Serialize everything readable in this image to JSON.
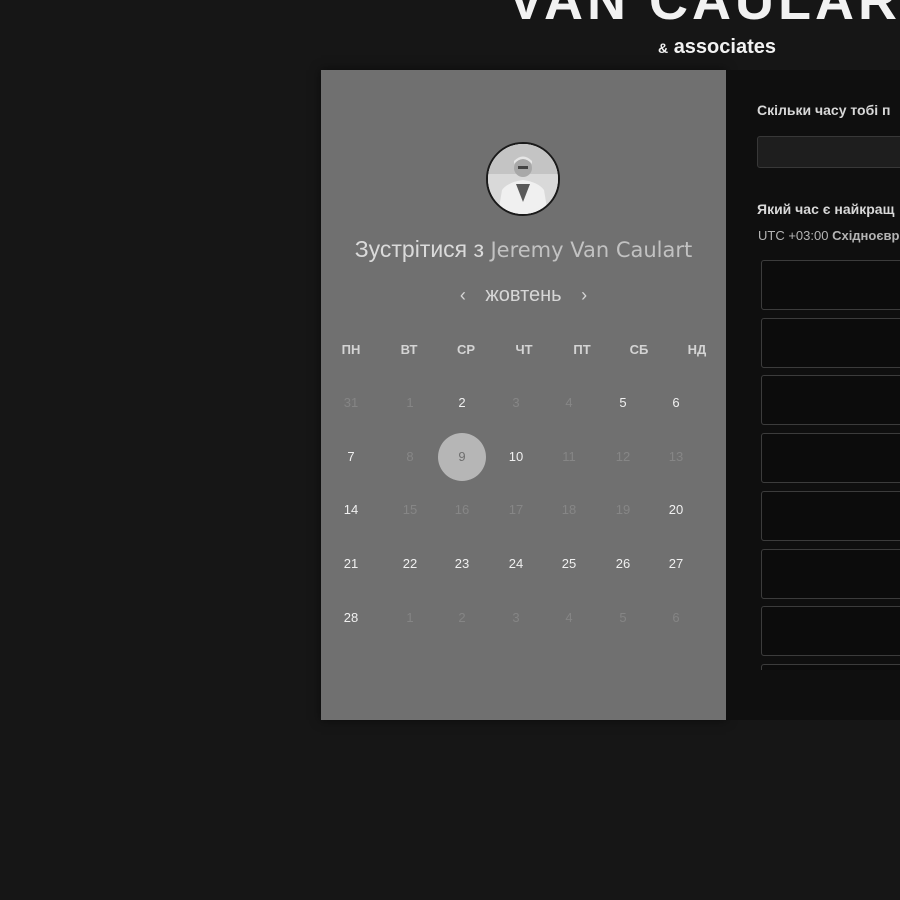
{
  "brand": {
    "name": "VAN CAULART",
    "sub_amp": "&",
    "sub": "associates"
  },
  "scheduler": {
    "avatar_alt": "Jeremy Van Caulart portrait",
    "title_prefix": "Зустрітися з",
    "host_name": "Jeremy Van Caulart",
    "month": "жовтень",
    "prev_arrow": "‹",
    "next_arrow": "›",
    "weekdays": [
      "ПН",
      "ВТ",
      "СР",
      "ЧТ",
      "ПТ",
      "СБ",
      "НД"
    ],
    "weeks": [
      [
        {
          "label": "31",
          "state": "other"
        },
        {
          "label": "1",
          "state": "disabled"
        },
        {
          "label": "2",
          "state": "available"
        },
        {
          "label": "3",
          "state": "disabled"
        },
        {
          "label": "4",
          "state": "disabled"
        },
        {
          "label": "5",
          "state": "available"
        },
        {
          "label": "6",
          "state": "available"
        }
      ],
      [
        {
          "label": "7",
          "state": "available"
        },
        {
          "label": "8",
          "state": "disabled"
        },
        {
          "label": "9",
          "state": "selected"
        },
        {
          "label": "10",
          "state": "available"
        },
        {
          "label": "11",
          "state": "disabled"
        },
        {
          "label": "12",
          "state": "disabled"
        },
        {
          "label": "13",
          "state": "disabled"
        }
      ],
      [
        {
          "label": "14",
          "state": "available"
        },
        {
          "label": "15",
          "state": "disabled"
        },
        {
          "label": "16",
          "state": "disabled"
        },
        {
          "label": "17",
          "state": "disabled"
        },
        {
          "label": "18",
          "state": "disabled"
        },
        {
          "label": "19",
          "state": "disabled"
        },
        {
          "label": "20",
          "state": "available"
        }
      ],
      [
        {
          "label": "21",
          "state": "available"
        },
        {
          "label": "22",
          "state": "available"
        },
        {
          "label": "23",
          "state": "available"
        },
        {
          "label": "24",
          "state": "available"
        },
        {
          "label": "25",
          "state": "available"
        },
        {
          "label": "26",
          "state": "available"
        },
        {
          "label": "27",
          "state": "available"
        }
      ],
      [
        {
          "label": "28",
          "state": "available"
        },
        {
          "label": "1",
          "state": "other"
        },
        {
          "label": "2",
          "state": "other"
        },
        {
          "label": "3",
          "state": "other"
        },
        {
          "label": "4",
          "state": "other"
        },
        {
          "label": "5",
          "state": "other"
        },
        {
          "label": "6",
          "state": "other"
        }
      ]
    ]
  },
  "booking": {
    "duration_question": "Скільки часу тобі п",
    "duration_value": "",
    "time_question": "Який час є найкращ",
    "timezone_offset": "UTC +03:00",
    "timezone_name": "Східноєвр",
    "time_slots": [
      "",
      "",
      "",
      "",
      "",
      "",
      "",
      ""
    ]
  },
  "colors": {
    "page_bg": "#161616",
    "calendar_bg": "#707070",
    "booking_bg": "#0f0f0f",
    "selected_day": "#b6b6b6",
    "brand_text": "#f2f2f2"
  }
}
